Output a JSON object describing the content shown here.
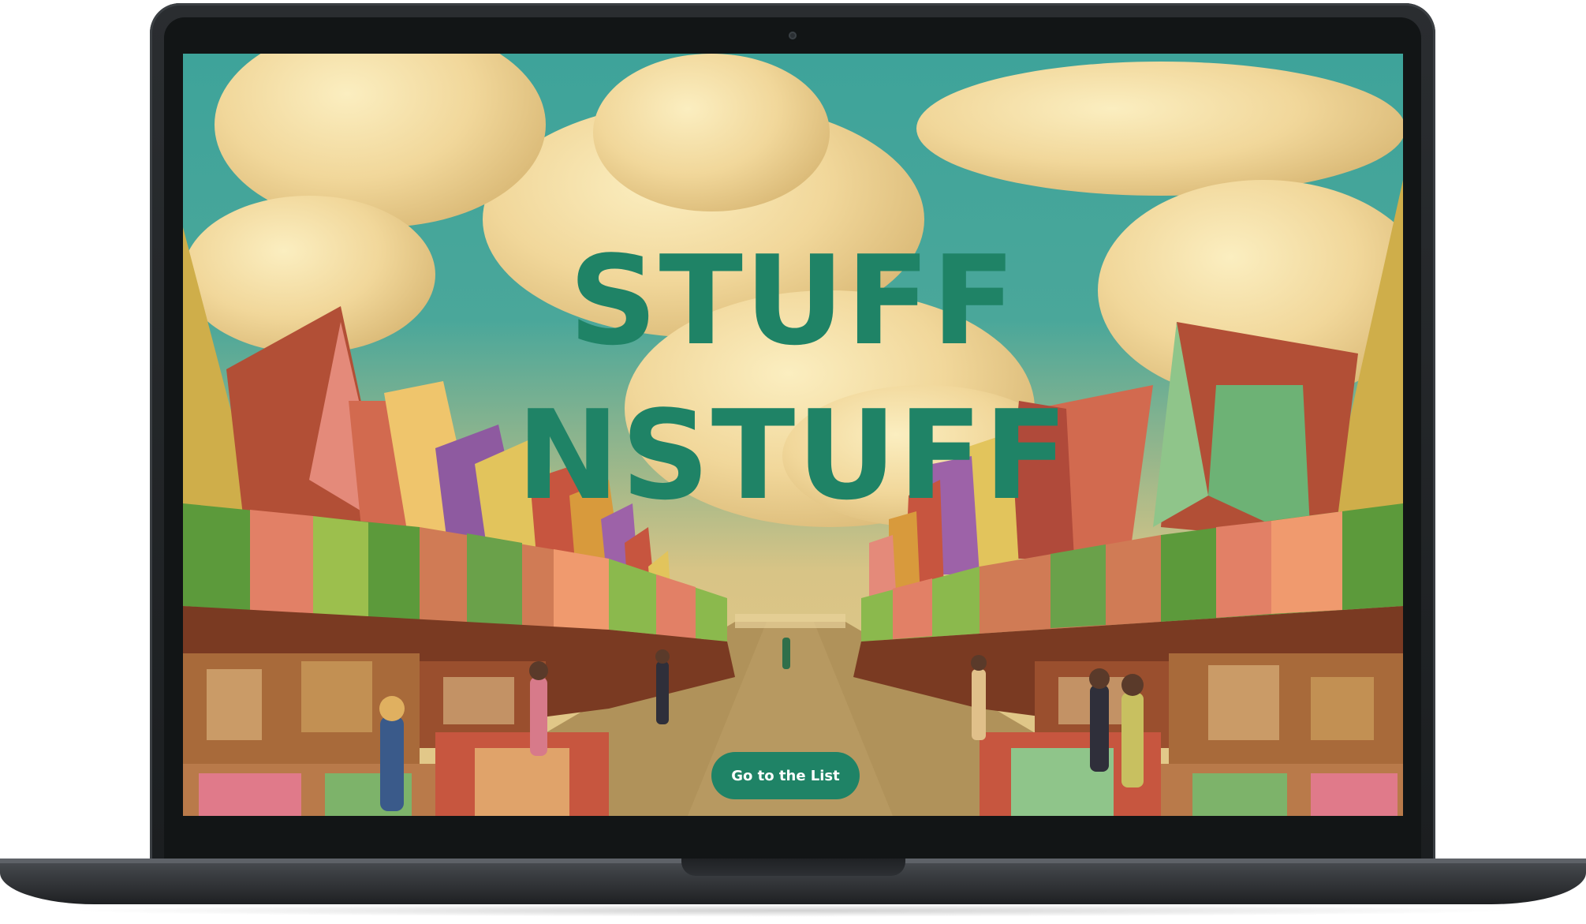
{
  "hero": {
    "title_line1": "STUFF",
    "title_line2": "NSTUFF",
    "cta_label": "Go to the List"
  },
  "colors": {
    "brand_green": "#1f8366",
    "button_text": "#ffffff",
    "sky_teal": "#3ea39a",
    "cloud_cream": "#f1d79a"
  },
  "device": {
    "type": "laptop",
    "finish": "space-gray"
  }
}
